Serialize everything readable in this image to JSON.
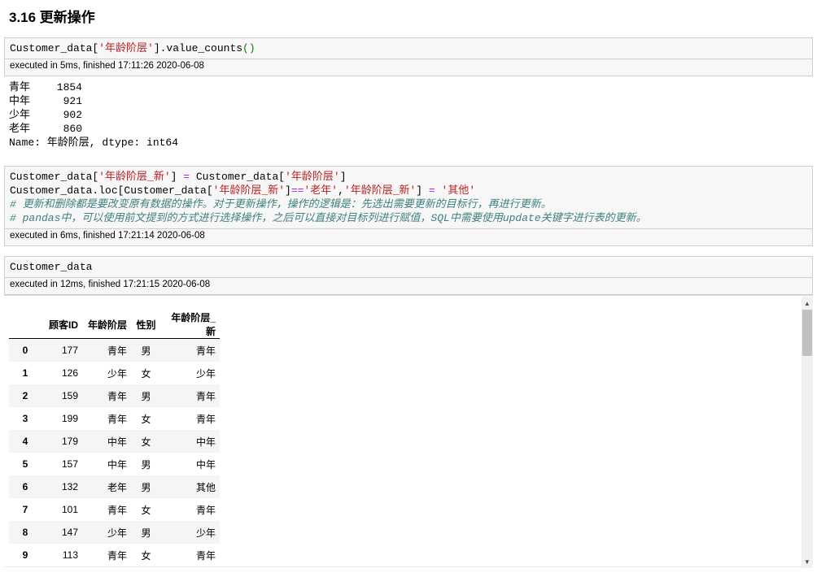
{
  "section": {
    "title": "3.16  更新操作"
  },
  "cell1": {
    "code_prefix": "Customer_data[",
    "code_str": "'年龄阶层'",
    "code_mid": "].value_counts",
    "code_paren": "()",
    "exec": "executed in 5ms, finished 17:11:26 2020-06-08"
  },
  "output1": {
    "rows": [
      {
        "name": "青年",
        "value": "1854"
      },
      {
        "name": "中年",
        "value": "921"
      },
      {
        "name": "少年",
        "value": "902"
      },
      {
        "name": "老年",
        "value": "860"
      }
    ],
    "footer": "Name: 年龄阶层, dtype: int64"
  },
  "cell2": {
    "line1_a": "Customer_data[",
    "line1_s1": "'年龄阶层_新'",
    "line1_b": "] ",
    "line1_eq": "=",
    "line1_c": " Customer_data[",
    "line1_s2": "'年龄阶层'",
    "line1_d": "]",
    "line2_a": "Customer_data.loc[Customer_data[",
    "line2_s1": "'年龄阶层_新'",
    "line2_b": "]",
    "line2_eq": "==",
    "line2_s2": "'老年'",
    "line2_c": ",",
    "line2_s3": "'年龄阶层_新'",
    "line2_d": "] ",
    "line2_eq2": "=",
    "line2_e": " ",
    "line2_s4": "'其他'",
    "comment1": "# 更新和删除都是要改变原有数据的操作。对于更新操作，操作的逻辑是：先选出需要更新的目标行，再进行更新。",
    "comment2": "# pandas中，可以使用前文提到的方式进行选择操作，之后可以直接对目标列进行赋值，SQL中需要使用update关键字进行表的更新。",
    "exec": "executed in 6ms, finished 17:21:14 2020-06-08"
  },
  "cell3": {
    "code": "Customer_data",
    "exec": "executed in 12ms, finished 17:21:15 2020-06-08"
  },
  "dataframe": {
    "columns": [
      "顾客ID",
      "年龄阶层",
      "性别",
      "年龄阶层_新"
    ],
    "rows": [
      {
        "index": "0",
        "id": "177",
        "age": "青年",
        "sex": "男",
        "new": "青年"
      },
      {
        "index": "1",
        "id": "126",
        "age": "少年",
        "sex": "女",
        "new": "少年"
      },
      {
        "index": "2",
        "id": "159",
        "age": "青年",
        "sex": "男",
        "new": "青年"
      },
      {
        "index": "3",
        "id": "199",
        "age": "青年",
        "sex": "女",
        "new": "青年"
      },
      {
        "index": "4",
        "id": "179",
        "age": "中年",
        "sex": "女",
        "new": "中年"
      },
      {
        "index": "5",
        "id": "157",
        "age": "中年",
        "sex": "男",
        "new": "中年"
      },
      {
        "index": "6",
        "id": "132",
        "age": "老年",
        "sex": "男",
        "new": "其他"
      },
      {
        "index": "7",
        "id": "101",
        "age": "青年",
        "sex": "女",
        "new": "青年"
      },
      {
        "index": "8",
        "id": "147",
        "age": "少年",
        "sex": "男",
        "new": "少年"
      },
      {
        "index": "9",
        "id": "113",
        "age": "青年",
        "sex": "女",
        "new": "青年"
      }
    ]
  },
  "scrollbar": {
    "up_icon": "▲",
    "down_icon": "▼"
  }
}
